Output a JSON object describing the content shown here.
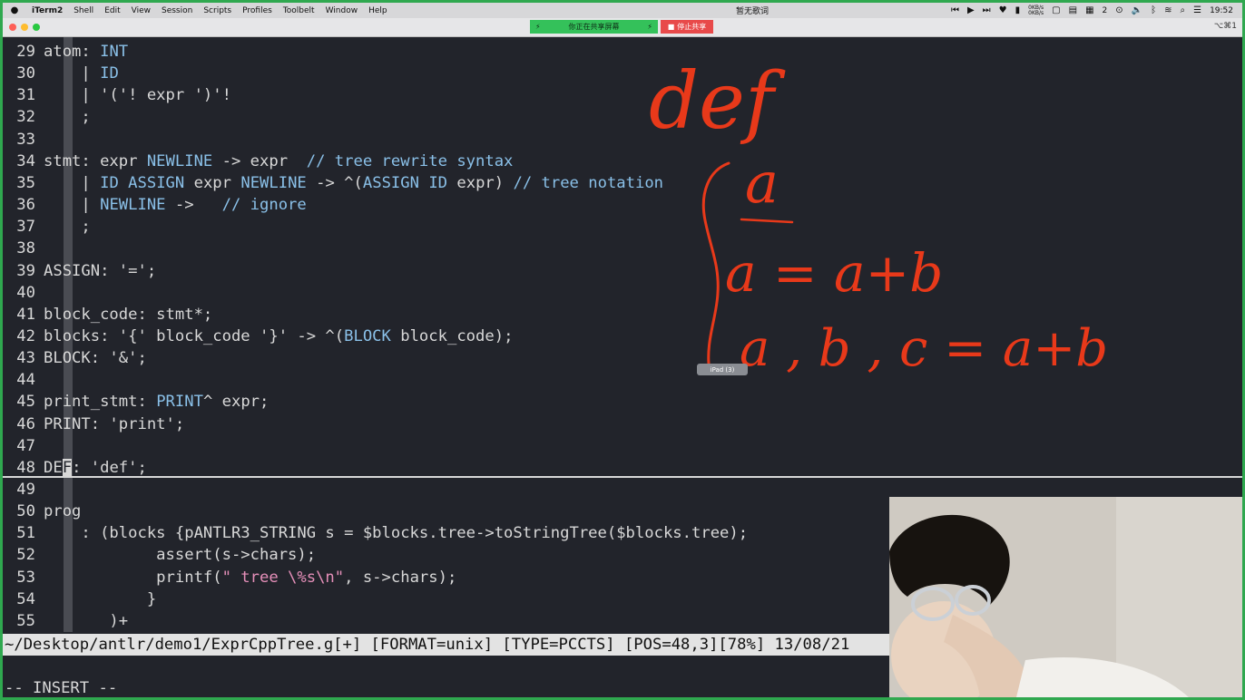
{
  "menubar": {
    "app": "iTerm2",
    "items": [
      "Shell",
      "Edit",
      "View",
      "Session",
      "Scripts",
      "Profiles",
      "Toolbelt",
      "Window",
      "Help"
    ],
    "now_playing": "暂无歌词",
    "net_up": "0KB/s",
    "net_down": "0KB/s",
    "notifications": "2",
    "clock": "19:52"
  },
  "titlebar": {
    "share_status": "你正在共享屏幕",
    "stop_share": "停止共享",
    "shortcut": "⌥⌘1"
  },
  "editor": {
    "lines": [
      {
        "n": "29",
        "code": "atom: INT"
      },
      {
        "n": "30",
        "code": "    | ID"
      },
      {
        "n": "31",
        "code": "    | '('! expr ')'!"
      },
      {
        "n": "32",
        "code": "    ;"
      },
      {
        "n": "33",
        "code": ""
      },
      {
        "n": "34",
        "code": "stmt: expr NEWLINE -> expr  // tree rewrite syntax"
      },
      {
        "n": "35",
        "code": "    | ID ASSIGN expr NEWLINE -> ^(ASSIGN ID expr) // tree notation"
      },
      {
        "n": "36",
        "code": "    | NEWLINE ->   // ignore"
      },
      {
        "n": "37",
        "code": "    ;"
      },
      {
        "n": "38",
        "code": ""
      },
      {
        "n": "39",
        "code": "ASSIGN: '=';"
      },
      {
        "n": "40",
        "code": ""
      },
      {
        "n": "41",
        "code": "block_code: stmt*;"
      },
      {
        "n": "42",
        "code": "blocks: '{' block_code '}' -> ^(BLOCK block_code);"
      },
      {
        "n": "43",
        "code": "BLOCK: '&';"
      },
      {
        "n": "44",
        "code": ""
      },
      {
        "n": "45",
        "code": "print_stmt: PRINT^ expr;"
      },
      {
        "n": "46",
        "code": "PRINT: 'print';"
      },
      {
        "n": "47",
        "code": ""
      },
      {
        "n": "48",
        "code": "DEF: 'def';"
      },
      {
        "n": "49",
        "code": ""
      },
      {
        "n": "50",
        "code": "prog"
      },
      {
        "n": "51",
        "code": "    : (blocks {pANTLR3_STRING s = $blocks.tree->toStringTree($blocks.tree);"
      },
      {
        "n": "52",
        "code": "            assert(s->chars);"
      },
      {
        "n": "53",
        "code": "            printf(\" tree \\%s\\n\", s->chars);"
      },
      {
        "n": "54",
        "code": "           }"
      },
      {
        "n": "55",
        "code": "       )+"
      }
    ],
    "status_line": "~/Desktop/antlr/demo1/ExprCppTree.g[+] [FORMAT=unix] [TYPE=PCCTS] [POS=48,3][78%] 13/08/21",
    "mode": "-- INSERT --"
  },
  "annotation": {
    "word": "def",
    "items": [
      "a",
      "a = a+b",
      "a , b , c = a+b"
    ],
    "ipad_tag": "iPad (3)",
    "ink_color": "#e8391a"
  },
  "colors": {
    "screen_border": "#2fa84f",
    "editor_bg": "#22242b",
    "keyword": "#8ac0e8",
    "string": "#e58fb9"
  }
}
